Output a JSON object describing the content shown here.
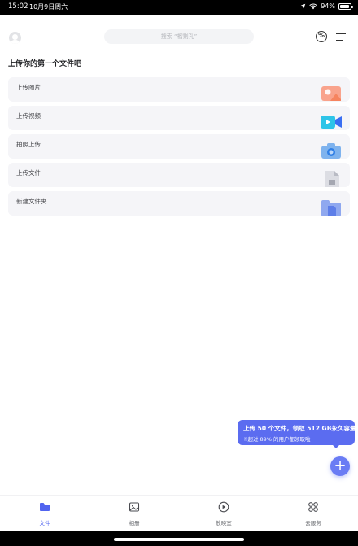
{
  "status": {
    "time": "15:02",
    "date": "10月9日周六",
    "battery": "94%",
    "battery_level": 0.94
  },
  "header": {
    "search_placeholder": "搜索 “榴剩孔”"
  },
  "main": {
    "section_title": "上传你的第一个文件吧",
    "items": [
      {
        "label": "上传图片",
        "icon": "image-upload-icon"
      },
      {
        "label": "上传视频",
        "icon": "video-upload-icon"
      },
      {
        "label": "拍照上传",
        "icon": "camera-upload-icon"
      },
      {
        "label": "上传文件",
        "icon": "file-upload-icon"
      },
      {
        "label": "新建文件夹",
        "icon": "new-folder-icon"
      }
    ]
  },
  "promo": {
    "title": "上传 50 个文件，领取 512 GB永久容量",
    "subtitle": "✌超过 89% 的用户都领取啦"
  },
  "tabs": [
    {
      "label": "文件",
      "icon": "folder-icon",
      "active": true
    },
    {
      "label": "相册",
      "icon": "photo-icon",
      "active": false
    },
    {
      "label": "放映室",
      "icon": "play-icon",
      "active": false
    },
    {
      "label": "云服务",
      "icon": "grid-icon",
      "active": false
    }
  ],
  "colors": {
    "accent": "#5164ef",
    "promo_bg": "#5b6cf0"
  }
}
